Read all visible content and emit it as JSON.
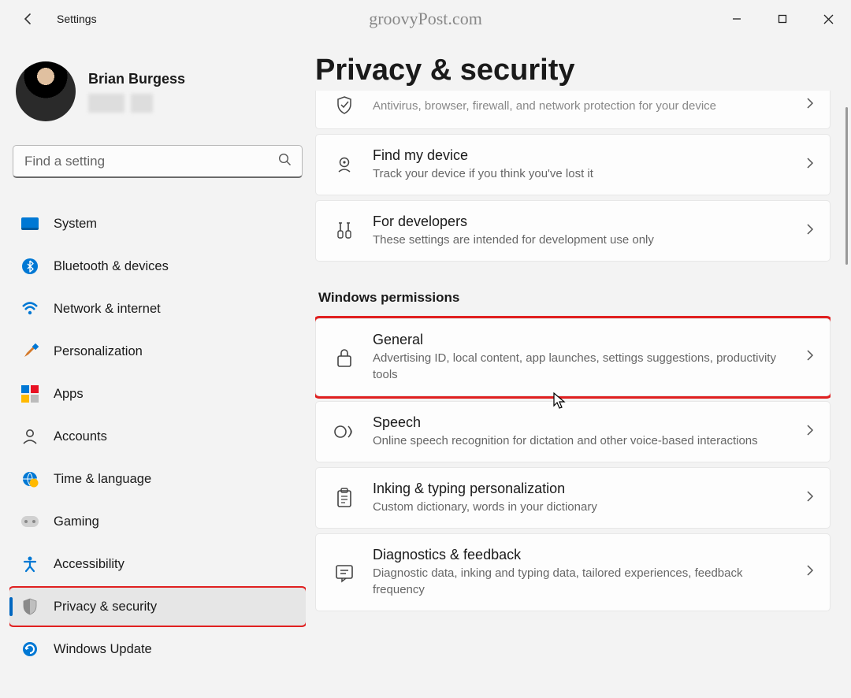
{
  "app": {
    "title": "Settings",
    "watermark": "groovyPost.com"
  },
  "profile": {
    "name": "Brian Burgess"
  },
  "search": {
    "placeholder": "Find a setting"
  },
  "nav": {
    "system": "System",
    "bluetooth": "Bluetooth & devices",
    "network": "Network & internet",
    "personalization": "Personalization",
    "apps": "Apps",
    "accounts": "Accounts",
    "time": "Time & language",
    "gaming": "Gaming",
    "accessibility": "Accessibility",
    "privacy": "Privacy & security",
    "update": "Windows Update"
  },
  "page": {
    "title": "Privacy & security",
    "section_permissions": "Windows permissions"
  },
  "cards": {
    "security": {
      "sub": "Antivirus, browser, firewall, and network protection for your device"
    },
    "findmydevice": {
      "title": "Find my device",
      "sub": "Track your device if you think you've lost it"
    },
    "developers": {
      "title": "For developers",
      "sub": "These settings are intended for development use only"
    },
    "general": {
      "title": "General",
      "sub": "Advertising ID, local content, app launches, settings suggestions, productivity tools"
    },
    "speech": {
      "title": "Speech",
      "sub": "Online speech recognition for dictation and other voice-based interactions"
    },
    "inking": {
      "title": "Inking & typing personalization",
      "sub": "Custom dictionary, words in your dictionary"
    },
    "diagnostics": {
      "title": "Diagnostics & feedback",
      "sub": "Diagnostic data, inking and typing data, tailored experiences, feedback frequency"
    }
  }
}
